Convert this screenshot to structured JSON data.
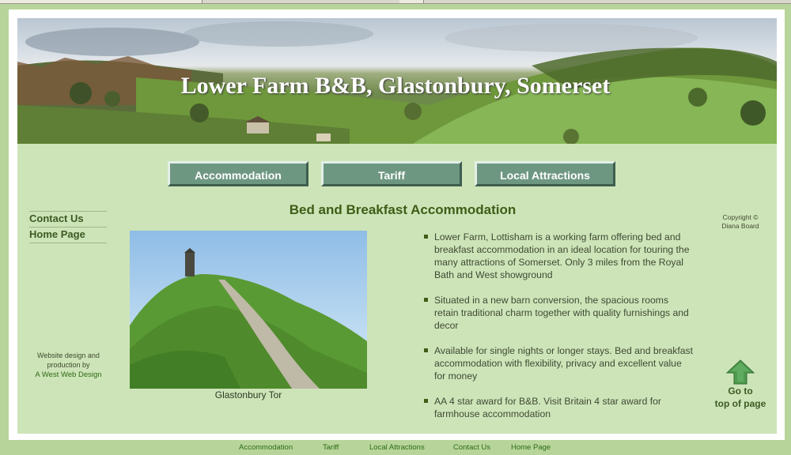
{
  "site": {
    "title": "Lower Farm B&B, Glastonbury, Somerset"
  },
  "nav": {
    "accommodation": "Accommodation",
    "tariff": "Tariff",
    "local_attractions": "Local Attractions"
  },
  "sidebar": {
    "contact_us": "Contact Us",
    "home_page": "Home Page"
  },
  "credit": {
    "line1": "Website design and",
    "line2": "production by",
    "link": "A West Web Design"
  },
  "main": {
    "heading": "Bed and Breakfast Accommodation",
    "photo_caption": "Glastonbury Tor",
    "features": [
      "Lower Farm, Lottisham is a working farm offering bed and breakfast accommodation in an ideal location for touring the many attractions of Somerset. Only 3 miles from the Royal Bath and West showground",
      "Situated in a new barn conversion, the spacious rooms retain traditional charm together with quality furnishings and decor",
      "Available for single nights or longer stays. Bed and breakfast accommodation with flexibility, privacy and excellent value for money",
      "AA 4 star award for B&B. Visit Britain 4 star award for farmhouse accommodation"
    ]
  },
  "copyright": {
    "line1": "Copyright ©",
    "line2": "Diana Board"
  },
  "top_link": {
    "line1": "Go to",
    "line2": "top of page"
  },
  "footer": {
    "accommodation": "Accommodation",
    "tariff": "Tariff",
    "local_attractions": "Local Attractions",
    "contact_us": "Contact Us",
    "home_page": "Home Page"
  },
  "colors": {
    "page_background": "#b7d59a",
    "panel": "#cde4b8",
    "nav_button": "#6e9782",
    "heading": "#3e5d17",
    "link": "#2f6a16"
  },
  "icons": {
    "top_arrow": "up-arrow-icon",
    "bullet": "square-bullet-icon"
  }
}
